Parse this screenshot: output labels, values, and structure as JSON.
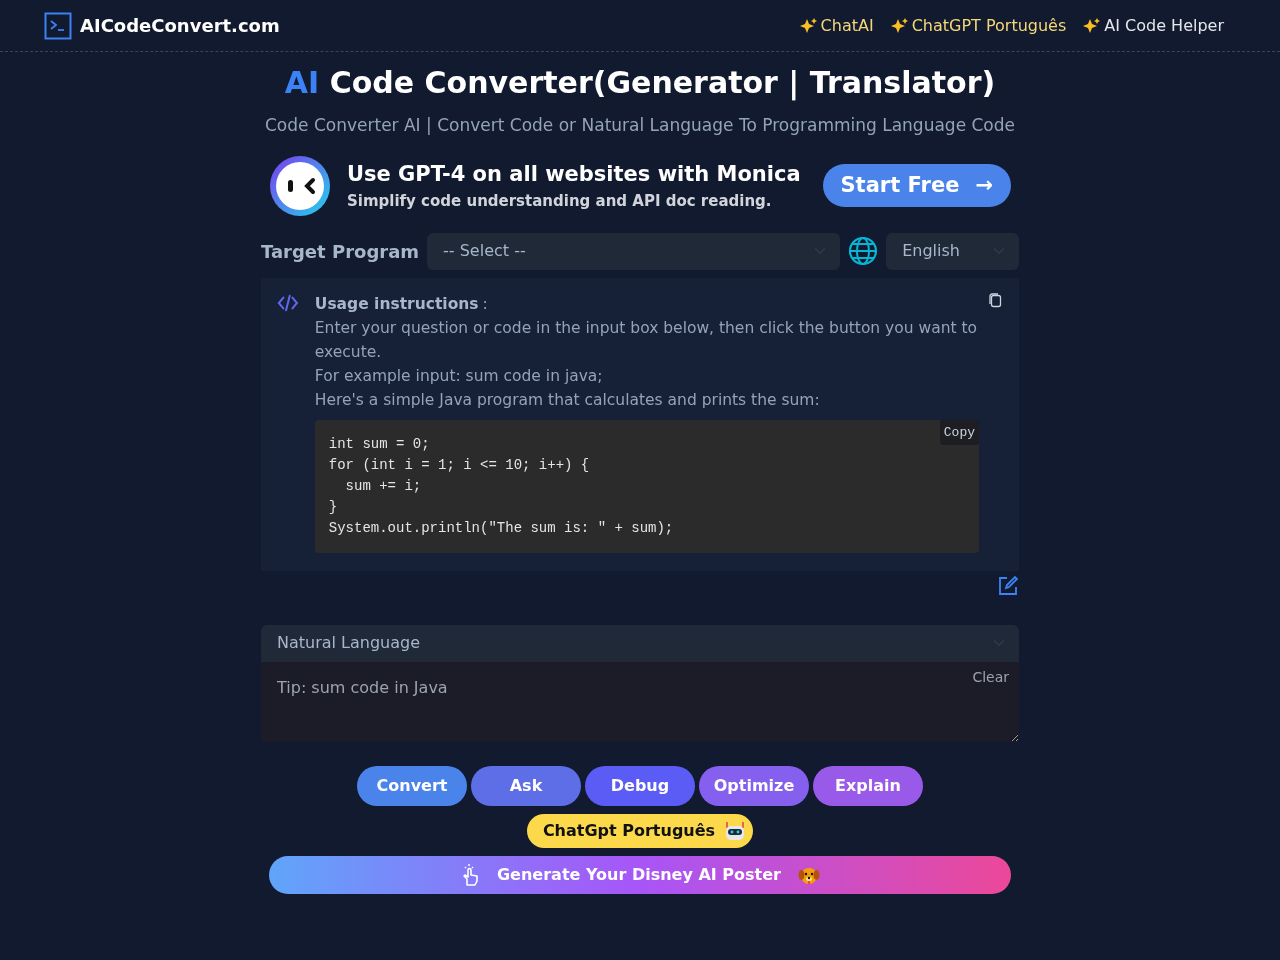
{
  "brand": {
    "name": "AICodeConvert.com"
  },
  "nav_links": [
    {
      "label": "ChatAI",
      "highlight": true
    },
    {
      "label": "ChatGPT Português",
      "highlight": true
    },
    {
      "label": "AI Code Helper",
      "highlight": false
    }
  ],
  "heading": {
    "accent": "AI",
    "title": "Code Converter(Generator | Translator)",
    "subtitle": "Code Converter AI | Convert Code or Natural Language To Programming Language Code"
  },
  "ad": {
    "title": "Use GPT-4 on all websites with Monica",
    "subtitle": "Simplify code understanding and API doc reading.",
    "button": "Start Free",
    "arrow": "→"
  },
  "target": {
    "label": "Target Program",
    "select": "-- Select --",
    "language": "English"
  },
  "usage": {
    "title": "Usage instructions",
    "colon": ":",
    "lines": [
      "Enter your question or code in the input box below, then click the button you want to execute.",
      "For example input: sum code in java;",
      "Here's a simple Java program that calculates and prints the sum:"
    ],
    "code": "int sum = 0;\nfor (int i = 1; i <= 10; i++) {\n  sum += i;\n}\nSystem.out.println(\"The sum is: \" + sum);",
    "copy": "Copy"
  },
  "input": {
    "source": "Natural Language",
    "placeholder": "Tip: sum code in Java",
    "clear": "Clear"
  },
  "actions": [
    {
      "label": "Convert",
      "color": "#4a84ea"
    },
    {
      "label": "Ask",
      "color": "#5e6ee6"
    },
    {
      "label": "Debug",
      "color": "#5b5cf6"
    },
    {
      "label": "Optimize",
      "color": "#8560ee"
    },
    {
      "label": "Explain",
      "color": "#9a5ae9"
    }
  ],
  "promo": {
    "label": "ChatGpt Português"
  },
  "poster": {
    "label": "Generate Your Disney AI Poster"
  }
}
